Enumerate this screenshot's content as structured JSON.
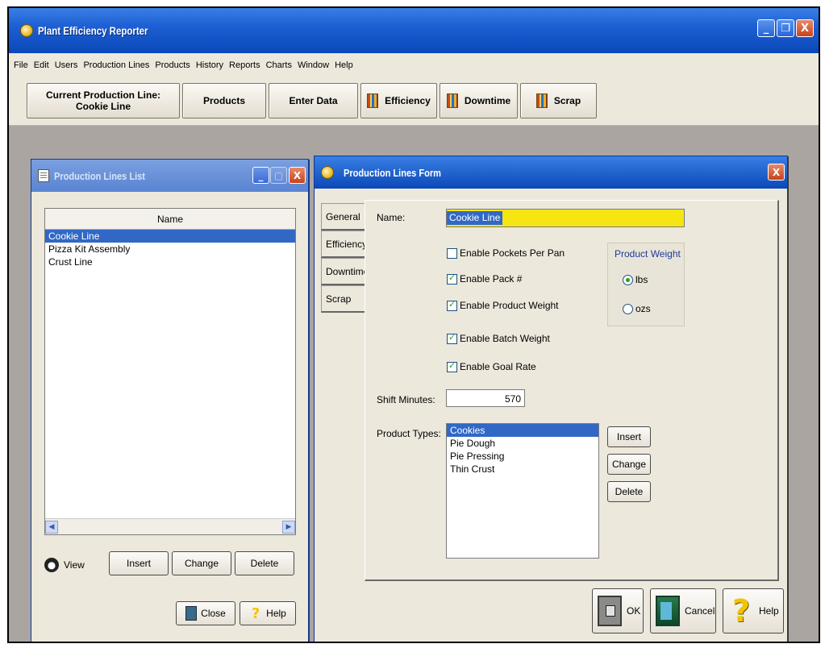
{
  "app": {
    "title": "Plant Efficiency Reporter",
    "window_buttons": {
      "minimize": "_",
      "restore": "❐",
      "close": "X"
    }
  },
  "menu": [
    "File",
    "Edit",
    "Users",
    "Production Lines",
    "Products",
    "History",
    "Reports",
    "Charts",
    "Window",
    "Help"
  ],
  "toolbar": {
    "current_line_label": "Current Production Line:",
    "current_line_value": "Cookie Line",
    "products": "Products",
    "enter_data": "Enter Data",
    "efficiency": "Efficiency",
    "downtime": "Downtime",
    "scrap": "Scrap"
  },
  "list_window": {
    "title": "Production Lines List",
    "column_header": "Name",
    "rows": [
      "Cookie Line",
      "Pizza Kit Assembly",
      "Crust Line"
    ],
    "selected_index": 0,
    "buttons": {
      "view": "View",
      "insert": "Insert",
      "change": "Change",
      "delete": "Delete",
      "close": "Close",
      "help": "Help"
    }
  },
  "form_window": {
    "title": "Production Lines Form",
    "tabs": [
      "General",
      "Efficiency",
      "Downtime",
      "Scrap"
    ],
    "name_label": "Name:",
    "name_value": "Cookie Line",
    "checkboxes": [
      {
        "label": "Enable Pockets Per Pan",
        "checked": false
      },
      {
        "label": "Enable Pack #",
        "checked": true
      },
      {
        "label": "Enable Product Weight",
        "checked": true
      },
      {
        "label": "Enable Batch Weight",
        "checked": true
      },
      {
        "label": "Enable Goal Rate",
        "checked": true
      }
    ],
    "weight_group": {
      "title": "Product Weight",
      "options": [
        "lbs",
        "ozs"
      ],
      "selected": "lbs"
    },
    "shift_label": "Shift Minutes:",
    "shift_value": "570",
    "product_types_label": "Product Types:",
    "product_types": [
      "Cookies",
      "Pie Dough",
      "Pie Pressing",
      "Thin Crust"
    ],
    "selected_product_type": 0,
    "side_buttons": {
      "insert": "Insert",
      "change": "Change",
      "delete": "Delete"
    },
    "bottom_buttons": {
      "ok": "OK",
      "cancel": "Cancel",
      "help": "Help"
    }
  }
}
